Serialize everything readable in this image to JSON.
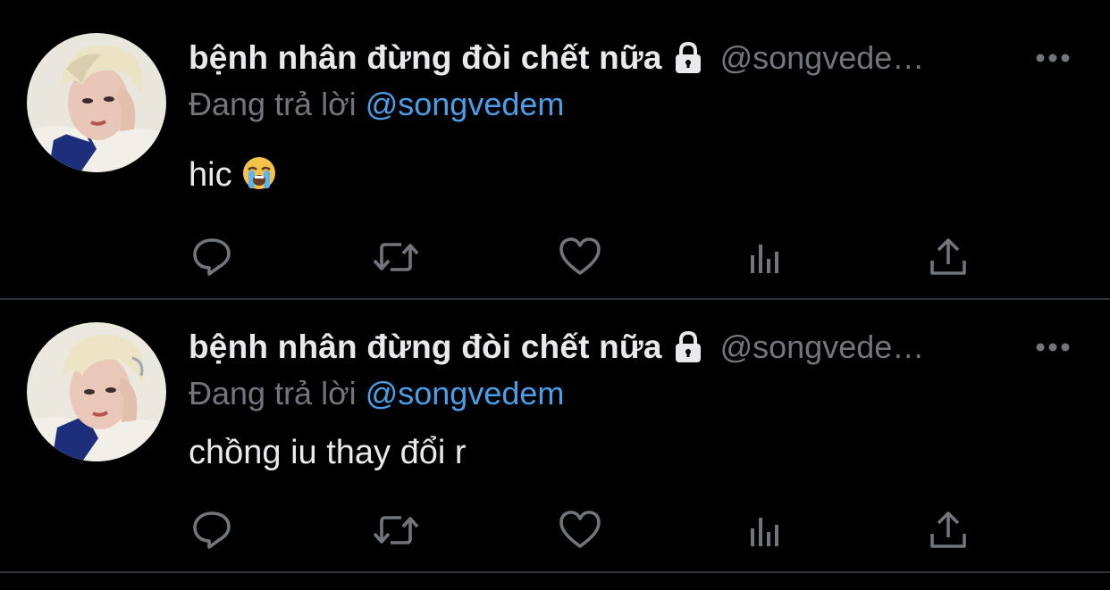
{
  "colors": {
    "background": "#000000",
    "text_primary": "#e7e9ea",
    "text_secondary": "#71767b",
    "mention_blue": "#4a9ee8",
    "divider": "#2f3336"
  },
  "tweets": [
    {
      "display_name": "bệnh nhân đừng đòi chết nữa",
      "protected_icon": "lock-icon",
      "handle": "@songvede…",
      "reply_prefix": "Đang trả lời",
      "reply_to": "@songvedem",
      "text": "hic",
      "emoji": "loudly-crying-face-emoji",
      "more_icon": "more-dots-icon",
      "actions": [
        "reply-icon",
        "retweet-icon",
        "like-icon",
        "analytics-icon",
        "share-icon"
      ]
    },
    {
      "display_name": "bệnh nhân đừng đòi chết nữa",
      "protected_icon": "lock-icon",
      "handle": "@songvede…",
      "reply_prefix": "Đang trả lời",
      "reply_to": "@songvedem",
      "text": "chồng iu thay đổi r",
      "more_icon": "more-dots-icon",
      "actions": [
        "reply-icon",
        "retweet-icon",
        "like-icon",
        "analytics-icon",
        "share-icon"
      ]
    }
  ]
}
